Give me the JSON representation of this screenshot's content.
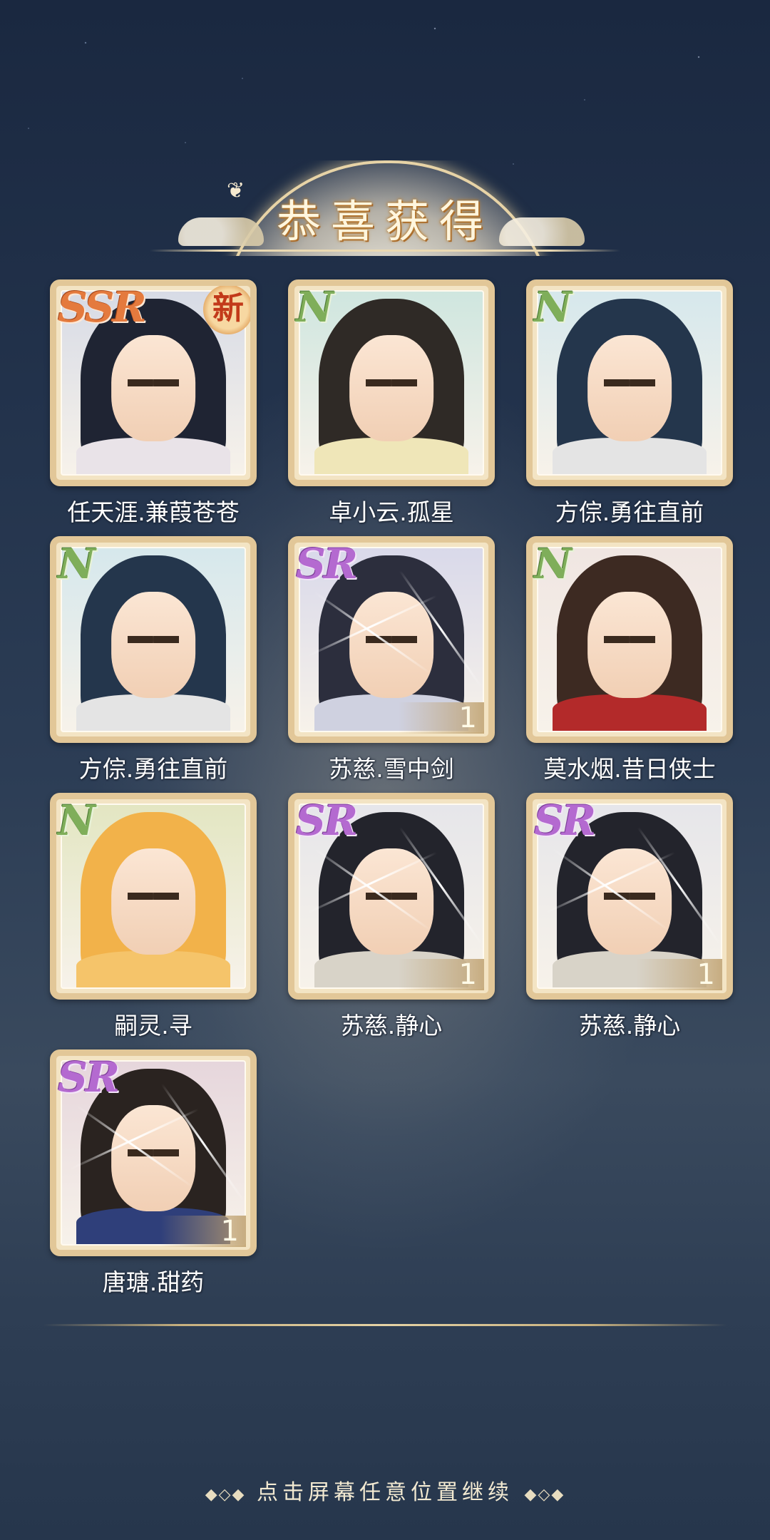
{
  "title": "恭喜获得",
  "continue_hint": "点击屏幕任意位置继续",
  "cards": [
    {
      "name": "任天涯.兼葭苍苍",
      "rarity": "SSR",
      "new_badge": "新",
      "count": "",
      "hair": "#1f2433",
      "bg": "#d7dbe6",
      "cloth": "#e9e3e8"
    },
    {
      "name": "卓小云.孤星",
      "rarity": "N",
      "new_badge": "",
      "count": "",
      "hair": "#2f2a26",
      "bg": "#cfe6df",
      "cloth": "#efe6b8"
    },
    {
      "name": "方倧.勇往直前",
      "rarity": "N",
      "new_badge": "",
      "count": "",
      "hair": "#24364c",
      "bg": "#d6e8ec",
      "cloth": "#e4e4e4"
    },
    {
      "name": "方倧.勇往直前",
      "rarity": "N",
      "new_badge": "",
      "count": "",
      "hair": "#24364c",
      "bg": "#d6e8ec",
      "cloth": "#e4e4e4"
    },
    {
      "name": "苏慈.雪中剑",
      "rarity": "SR",
      "new_badge": "",
      "count": "1",
      "hair": "#2c2e3d",
      "bg": "#d9d9ea",
      "cloth": "#cfd1e0"
    },
    {
      "name": "莫水烟.昔日侠士",
      "rarity": "N",
      "new_badge": "",
      "count": "",
      "hair": "#3d2a22",
      "bg": "#f0e6e2",
      "cloth": "#b32a2a"
    },
    {
      "name": "嗣灵.寻",
      "rarity": "N",
      "new_badge": "",
      "count": "",
      "hair": "#f2b24a",
      "bg": "#e3e6c2",
      "cloth": "#f5c46a"
    },
    {
      "name": "苏慈.静心",
      "rarity": "SR",
      "new_badge": "",
      "count": "1",
      "hair": "#23242c",
      "bg": "#e6e6ea",
      "cloth": "#d8d3c8"
    },
    {
      "name": "苏慈.静心",
      "rarity": "SR",
      "new_badge": "",
      "count": "1",
      "hair": "#23242c",
      "bg": "#e6e6ea",
      "cloth": "#d8d3c8"
    },
    {
      "name": "唐瑭.甜药",
      "rarity": "SR",
      "new_badge": "",
      "count": "1",
      "hair": "#2a2320",
      "bg": "#e6d6dc",
      "cloth": "#2f3f7a"
    }
  ]
}
